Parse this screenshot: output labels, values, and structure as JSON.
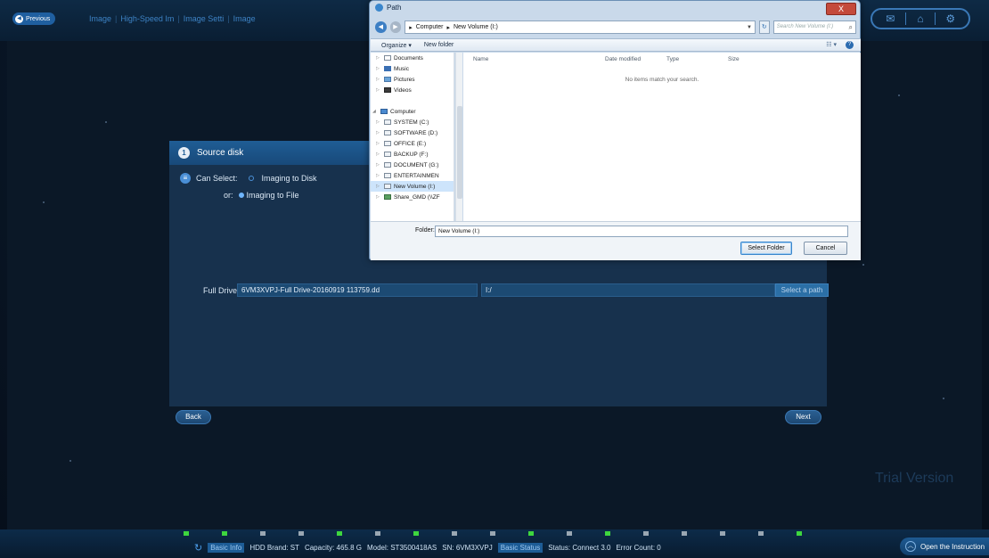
{
  "header": {
    "prev_label": "Previous",
    "crumbs": [
      "Image",
      "High-Speed Im",
      "Image Setti",
      "Image"
    ],
    "icons": [
      "email-icon",
      "home-icon",
      "settings-icon"
    ]
  },
  "panel": {
    "step_number": "1",
    "title": "Source disk",
    "can_select_label": "Can Select:",
    "option_disk": "Imaging to Disk",
    "or_label": "or:",
    "option_file": "Imaging to File",
    "selected_option": "Imaging to File",
    "drive_label": "Full Drive",
    "drive_file": "6VM3XVPJ-Full Drive-20160919 113759.dd",
    "drive_path": "I:/",
    "select_path_label": "Select a path"
  },
  "buttons": {
    "back": "Back",
    "next": "Next"
  },
  "trial_text": "Trial Version",
  "status_bar": {
    "basic_info_tag": "Basic Info",
    "hdd_brand": "HDD Brand: ST",
    "capacity": "Capacity: 465.8 G",
    "model": "Model: ST3500418AS",
    "sn": "SN:   6VM3XVPJ",
    "basic_status_tag": "Basic Status",
    "status": "Status: Connect 3.0",
    "error_count": "Error Count: 0",
    "led_colors": [
      "green",
      "green",
      "grey",
      "grey",
      "green",
      "grey",
      "green",
      "grey",
      "grey",
      "green",
      "grey",
      "green",
      "grey",
      "grey",
      "grey",
      "grey",
      "green"
    ]
  },
  "instruction_label": "Open the Instruction",
  "dialog": {
    "title": "Path",
    "close_label": "X",
    "address": [
      "Computer",
      "New Volume (I:)"
    ],
    "search_placeholder": "Search New Volume (I:)",
    "organize_label": "Organize",
    "new_folder_label": "New folder",
    "nav_items": [
      {
        "label": "Documents",
        "icon": "doc"
      },
      {
        "label": "Music",
        "icon": "music"
      },
      {
        "label": "Pictures",
        "icon": "pic"
      },
      {
        "label": "Videos",
        "icon": "vid"
      },
      {
        "label": "",
        "icon": ""
      },
      {
        "label": "Computer",
        "icon": "pc"
      },
      {
        "label": "SYSTEM (C:)",
        "icon": "drive"
      },
      {
        "label": "SOFTWARE (D:)",
        "icon": "drive"
      },
      {
        "label": "OFFICE (E:)",
        "icon": "drive"
      },
      {
        "label": "BACKUP (F:)",
        "icon": "drive"
      },
      {
        "label": "DOCUMENT (G:)",
        "icon": "drive"
      },
      {
        "label": "ENTERTAINMEN",
        "icon": "drive"
      },
      {
        "label": "New Volume (I:)",
        "icon": "drive",
        "selected": true
      },
      {
        "label": "Share_GMD (\\\\ZF",
        "icon": "net"
      }
    ],
    "columns": [
      "Name",
      "Date modified",
      "Type",
      "Size"
    ],
    "empty_message": "No items match your search.",
    "folder_label": "Folder:",
    "folder_value": "New Volume (I:)",
    "select_folder_label": "Select Folder",
    "cancel_label": "Cancel"
  }
}
